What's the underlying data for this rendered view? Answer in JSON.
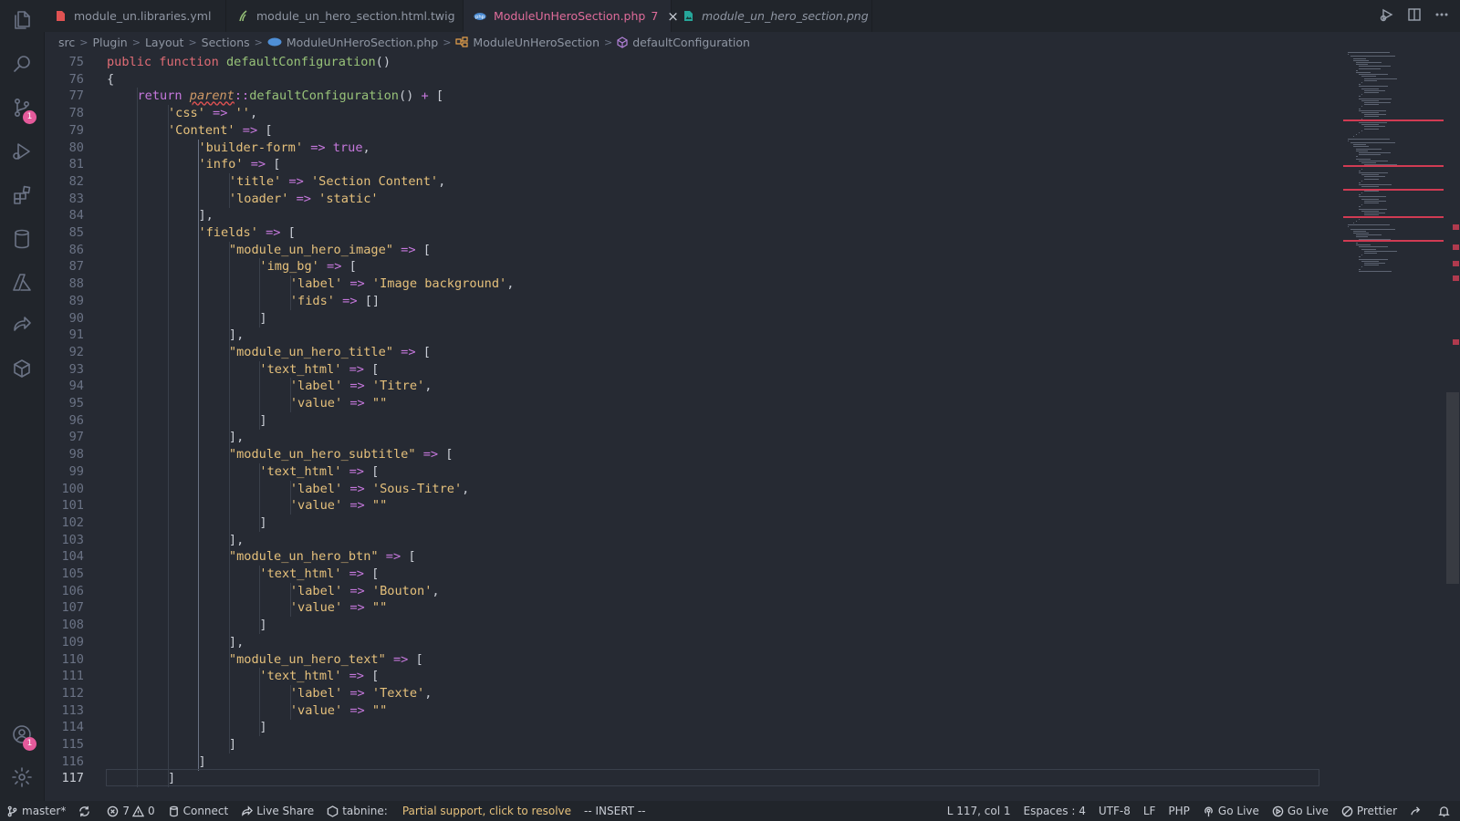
{
  "activity_bar": {
    "items": [
      {
        "name": "explorer-icon"
      },
      {
        "name": "search-icon"
      },
      {
        "name": "source-control-icon",
        "badge": "1"
      },
      {
        "name": "run-debug-icon"
      },
      {
        "name": "extensions-icon"
      },
      {
        "name": "database-icon"
      },
      {
        "name": "azure-icon"
      },
      {
        "name": "live-share-icon"
      },
      {
        "name": "container-icon"
      }
    ],
    "accounts_badge": "1"
  },
  "tabs": [
    {
      "label": "module_un.libraries.yml",
      "icon": "yaml-file-icon",
      "icon_color": "#e05252"
    },
    {
      "label": "module_un_hero_section.html.twig",
      "icon": "twig-file-icon",
      "icon_color": "#98c379"
    },
    {
      "label": "ModuleUnHeroSection.php",
      "problems": "7",
      "icon": "php-file-icon",
      "icon_color": "#61afef",
      "active": true
    },
    {
      "label": "module_un_hero_section.png",
      "icon": "image-file-icon",
      "icon_color": "#26a69a"
    }
  ],
  "breadcrumb": [
    "src",
    "Plugin",
    "Layout",
    "Sections",
    "ModuleUnHeroSection.php",
    "ModuleUnHeroSection",
    "defaultConfiguration"
  ],
  "editor": {
    "lines": [
      {
        "n": "75",
        "indent": 1,
        "tokens": [
          [
            "kw2",
            "public "
          ],
          [
            "kw2",
            "function "
          ],
          [
            "fn",
            "defaultConfiguration"
          ],
          [
            "punc",
            "()"
          ]
        ]
      },
      {
        "n": "76",
        "indent": 1,
        "tokens": [
          [
            "punc",
            "{"
          ]
        ]
      },
      {
        "n": "77",
        "indent": 2,
        "tokens": [
          [
            "kw",
            "return "
          ],
          [
            "par",
            "parent"
          ],
          [
            "op",
            "::"
          ],
          [
            "fn",
            "defaultConfiguration"
          ],
          [
            "punc",
            "() "
          ],
          [
            "op",
            "+ "
          ],
          [
            "punc",
            "["
          ]
        ]
      },
      {
        "n": "78",
        "indent": 3,
        "tokens": [
          [
            "str",
            "'css'"
          ],
          [
            "op",
            " => "
          ],
          [
            "str",
            "''"
          ],
          [
            "punc",
            ","
          ]
        ]
      },
      {
        "n": "79",
        "indent": 3,
        "tokens": [
          [
            "str",
            "'Content'"
          ],
          [
            "op",
            " => "
          ],
          [
            "punc",
            "["
          ]
        ]
      },
      {
        "n": "80",
        "indent": 4,
        "tokens": [
          [
            "str",
            "'builder-form'"
          ],
          [
            "op",
            " => "
          ],
          [
            "bool",
            "true"
          ],
          [
            "punc",
            ","
          ]
        ]
      },
      {
        "n": "81",
        "indent": 4,
        "tokens": [
          [
            "str",
            "'info'"
          ],
          [
            "op",
            " => "
          ],
          [
            "punc",
            "["
          ]
        ]
      },
      {
        "n": "82",
        "indent": 5,
        "tokens": [
          [
            "str",
            "'title'"
          ],
          [
            "op",
            " => "
          ],
          [
            "str",
            "'Section Content'"
          ],
          [
            "punc",
            ","
          ]
        ]
      },
      {
        "n": "83",
        "indent": 5,
        "tokens": [
          [
            "str",
            "'loader'"
          ],
          [
            "op",
            " => "
          ],
          [
            "str",
            "'static'"
          ]
        ]
      },
      {
        "n": "84",
        "indent": 4,
        "tokens": [
          [
            "punc",
            "],"
          ]
        ]
      },
      {
        "n": "85",
        "indent": 4,
        "tokens": [
          [
            "str",
            "'fields'"
          ],
          [
            "op",
            " => "
          ],
          [
            "punc",
            "["
          ]
        ]
      },
      {
        "n": "86",
        "indent": 5,
        "tokens": [
          [
            "dq",
            "\"module_un_hero_image\""
          ],
          [
            "op",
            " => "
          ],
          [
            "punc",
            "["
          ]
        ]
      },
      {
        "n": "87",
        "indent": 6,
        "tokens": [
          [
            "str",
            "'img_bg'"
          ],
          [
            "op",
            " => "
          ],
          [
            "punc",
            "["
          ]
        ]
      },
      {
        "n": "88",
        "indent": 7,
        "tokens": [
          [
            "str",
            "'label'"
          ],
          [
            "op",
            " => "
          ],
          [
            "str",
            "'Image background'"
          ],
          [
            "punc",
            ","
          ]
        ]
      },
      {
        "n": "89",
        "indent": 7,
        "tokens": [
          [
            "str",
            "'fids'"
          ],
          [
            "op",
            " => "
          ],
          [
            "punc",
            "[]"
          ]
        ]
      },
      {
        "n": "90",
        "indent": 6,
        "tokens": [
          [
            "punc",
            "]"
          ]
        ]
      },
      {
        "n": "91",
        "indent": 5,
        "tokens": [
          [
            "punc",
            "],"
          ]
        ]
      },
      {
        "n": "92",
        "indent": 5,
        "tokens": [
          [
            "dq",
            "\"module_un_hero_title\""
          ],
          [
            "op",
            " => "
          ],
          [
            "punc",
            "["
          ]
        ]
      },
      {
        "n": "93",
        "indent": 6,
        "tokens": [
          [
            "str",
            "'text_html'"
          ],
          [
            "op",
            " => "
          ],
          [
            "punc",
            "["
          ]
        ]
      },
      {
        "n": "94",
        "indent": 7,
        "tokens": [
          [
            "str",
            "'label'"
          ],
          [
            "op",
            " => "
          ],
          [
            "str",
            "'Titre'"
          ],
          [
            "punc",
            ","
          ]
        ]
      },
      {
        "n": "95",
        "indent": 7,
        "tokens": [
          [
            "str",
            "'value'"
          ],
          [
            "op",
            " => "
          ],
          [
            "dq",
            "\"\""
          ]
        ]
      },
      {
        "n": "96",
        "indent": 6,
        "tokens": [
          [
            "punc",
            "]"
          ]
        ]
      },
      {
        "n": "97",
        "indent": 5,
        "tokens": [
          [
            "punc",
            "],"
          ]
        ]
      },
      {
        "n": "98",
        "indent": 5,
        "tokens": [
          [
            "dq",
            "\"module_un_hero_subtitle\""
          ],
          [
            "op",
            " => "
          ],
          [
            "punc",
            "["
          ]
        ]
      },
      {
        "n": "99",
        "indent": 6,
        "tokens": [
          [
            "str",
            "'text_html'"
          ],
          [
            "op",
            " => "
          ],
          [
            "punc",
            "["
          ]
        ]
      },
      {
        "n": "100",
        "indent": 7,
        "tokens": [
          [
            "str",
            "'label'"
          ],
          [
            "op",
            " => "
          ],
          [
            "str",
            "'Sous-Titre'"
          ],
          [
            "punc",
            ","
          ]
        ]
      },
      {
        "n": "101",
        "indent": 7,
        "tokens": [
          [
            "str",
            "'value'"
          ],
          [
            "op",
            " => "
          ],
          [
            "dq",
            "\"\""
          ]
        ]
      },
      {
        "n": "102",
        "indent": 6,
        "tokens": [
          [
            "punc",
            "]"
          ]
        ]
      },
      {
        "n": "103",
        "indent": 5,
        "tokens": [
          [
            "punc",
            "],"
          ]
        ]
      },
      {
        "n": "104",
        "indent": 5,
        "tokens": [
          [
            "dq",
            "\"module_un_hero_btn\""
          ],
          [
            "op",
            " => "
          ],
          [
            "punc",
            "["
          ]
        ]
      },
      {
        "n": "105",
        "indent": 6,
        "tokens": [
          [
            "str",
            "'text_html'"
          ],
          [
            "op",
            " => "
          ],
          [
            "punc",
            "["
          ]
        ]
      },
      {
        "n": "106",
        "indent": 7,
        "tokens": [
          [
            "str",
            "'label'"
          ],
          [
            "op",
            " => "
          ],
          [
            "str",
            "'Bouton'"
          ],
          [
            "punc",
            ","
          ]
        ]
      },
      {
        "n": "107",
        "indent": 7,
        "tokens": [
          [
            "str",
            "'value'"
          ],
          [
            "op",
            " => "
          ],
          [
            "dq",
            "\"\""
          ]
        ]
      },
      {
        "n": "108",
        "indent": 6,
        "tokens": [
          [
            "punc",
            "]"
          ]
        ]
      },
      {
        "n": "109",
        "indent": 5,
        "tokens": [
          [
            "punc",
            "],"
          ]
        ]
      },
      {
        "n": "110",
        "indent": 5,
        "tokens": [
          [
            "dq",
            "\"module_un_hero_text\""
          ],
          [
            "op",
            " => "
          ],
          [
            "punc",
            "["
          ]
        ]
      },
      {
        "n": "111",
        "indent": 6,
        "tokens": [
          [
            "str",
            "'text_html'"
          ],
          [
            "op",
            " => "
          ],
          [
            "punc",
            "["
          ]
        ]
      },
      {
        "n": "112",
        "indent": 7,
        "tokens": [
          [
            "str",
            "'label'"
          ],
          [
            "op",
            " => "
          ],
          [
            "str",
            "'Texte'"
          ],
          [
            "punc",
            ","
          ]
        ]
      },
      {
        "n": "113",
        "indent": 7,
        "tokens": [
          [
            "str",
            "'value'"
          ],
          [
            "op",
            " => "
          ],
          [
            "dq",
            "\"\""
          ]
        ]
      },
      {
        "n": "114",
        "indent": 6,
        "tokens": [
          [
            "punc",
            "]"
          ]
        ]
      },
      {
        "n": "115",
        "indent": 5,
        "tokens": [
          [
            "punc",
            "]"
          ]
        ]
      },
      {
        "n": "116",
        "indent": 4,
        "tokens": [
          [
            "punc",
            "]"
          ]
        ]
      },
      {
        "n": "117",
        "indent": 3,
        "tokens": [
          [
            "punc",
            "]"
          ]
        ],
        "current": true
      }
    ]
  },
  "status_bar": {
    "branch": "master*",
    "errors": "7",
    "warnings": "0",
    "connect": "Connect",
    "live_share": "Live Share",
    "tabnine": "tabnine:",
    "tabnine_status": "Partial support, click to resolve",
    "mode": "-- INSERT --",
    "position": "L 117, col 1",
    "indent": "Espaces : 4",
    "encoding": "UTF-8",
    "eol": "LF",
    "language": "PHP",
    "go_live_1": "Go Live",
    "go_live_2": "Go Live",
    "prettier": "Prettier"
  }
}
